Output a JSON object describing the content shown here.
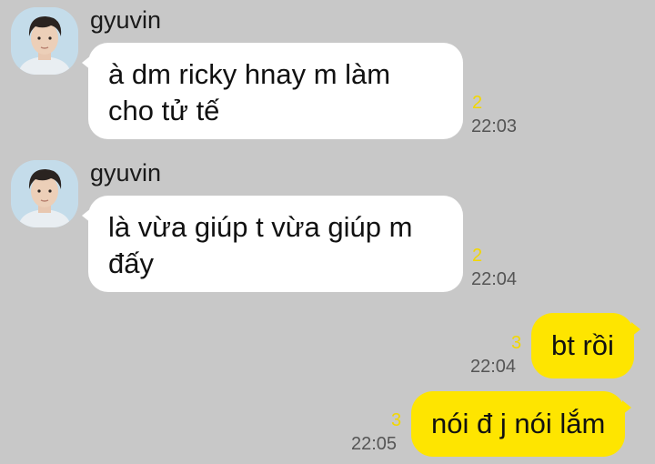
{
  "messages": [
    {
      "direction": "incoming",
      "sender": "gyuvin",
      "text_lines": [
        "à dm ricky hnay m làm",
        "cho tử tế"
      ],
      "unread": "2",
      "time": "22:03"
    },
    {
      "direction": "incoming",
      "sender": "gyuvin",
      "text_lines": [
        "là vừa giúp t vừa giúp m",
        "đấy"
      ],
      "unread": "2",
      "time": "22:04"
    },
    {
      "direction": "outgoing",
      "text": "bt rồi",
      "unread": "3",
      "time": "22:04"
    },
    {
      "direction": "outgoing",
      "text": "nói đ j nói lắm",
      "unread": "3",
      "time": "22:05"
    }
  ],
  "colors": {
    "background": "#c8c8c8",
    "incoming_bubble": "#ffffff",
    "outgoing_bubble": "#fee500",
    "unread_count": "#f2d700",
    "timestamp": "#555555"
  },
  "icons": {
    "avatar": "profile-photo-avatar-icon"
  }
}
